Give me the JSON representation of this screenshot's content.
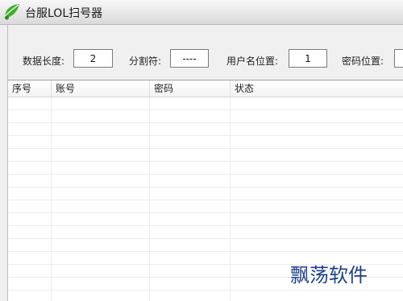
{
  "window": {
    "title": "台服LOL扫号器",
    "icon": "lol-leaf-icon"
  },
  "settings": {
    "data_length_label": "数据长度:",
    "data_length_value": "2",
    "separator_label": "分割符:",
    "separator_value": "----",
    "username_pos_label": "用户名位置:",
    "username_pos_value": "1",
    "password_pos_label": "密码位置:",
    "password_pos_value": ""
  },
  "table": {
    "columns": [
      "序号",
      "账号",
      "密码",
      "状态"
    ],
    "rows": []
  },
  "watermark": {
    "text": "飘荡软件"
  },
  "colors": {
    "accent_green": "#3fae2a",
    "watermark_blue": "#1c3f8e"
  }
}
